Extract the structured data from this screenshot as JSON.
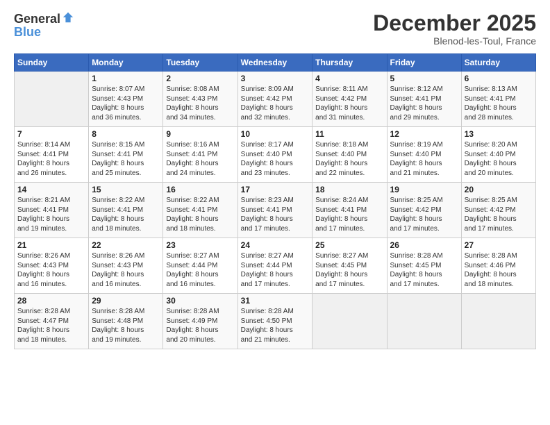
{
  "header": {
    "logo_general": "General",
    "logo_blue": "Blue",
    "month": "December 2025",
    "location": "Blenod-les-Toul, France"
  },
  "weekdays": [
    "Sunday",
    "Monday",
    "Tuesday",
    "Wednesday",
    "Thursday",
    "Friday",
    "Saturday"
  ],
  "weeks": [
    [
      {
        "day": "",
        "info": ""
      },
      {
        "day": "1",
        "info": "Sunrise: 8:07 AM\nSunset: 4:43 PM\nDaylight: 8 hours\nand 36 minutes."
      },
      {
        "day": "2",
        "info": "Sunrise: 8:08 AM\nSunset: 4:43 PM\nDaylight: 8 hours\nand 34 minutes."
      },
      {
        "day": "3",
        "info": "Sunrise: 8:09 AM\nSunset: 4:42 PM\nDaylight: 8 hours\nand 32 minutes."
      },
      {
        "day": "4",
        "info": "Sunrise: 8:11 AM\nSunset: 4:42 PM\nDaylight: 8 hours\nand 31 minutes."
      },
      {
        "day": "5",
        "info": "Sunrise: 8:12 AM\nSunset: 4:41 PM\nDaylight: 8 hours\nand 29 minutes."
      },
      {
        "day": "6",
        "info": "Sunrise: 8:13 AM\nSunset: 4:41 PM\nDaylight: 8 hours\nand 28 minutes."
      }
    ],
    [
      {
        "day": "7",
        "info": "Sunrise: 8:14 AM\nSunset: 4:41 PM\nDaylight: 8 hours\nand 26 minutes."
      },
      {
        "day": "8",
        "info": "Sunrise: 8:15 AM\nSunset: 4:41 PM\nDaylight: 8 hours\nand 25 minutes."
      },
      {
        "day": "9",
        "info": "Sunrise: 8:16 AM\nSunset: 4:41 PM\nDaylight: 8 hours\nand 24 minutes."
      },
      {
        "day": "10",
        "info": "Sunrise: 8:17 AM\nSunset: 4:40 PM\nDaylight: 8 hours\nand 23 minutes."
      },
      {
        "day": "11",
        "info": "Sunrise: 8:18 AM\nSunset: 4:40 PM\nDaylight: 8 hours\nand 22 minutes."
      },
      {
        "day": "12",
        "info": "Sunrise: 8:19 AM\nSunset: 4:40 PM\nDaylight: 8 hours\nand 21 minutes."
      },
      {
        "day": "13",
        "info": "Sunrise: 8:20 AM\nSunset: 4:40 PM\nDaylight: 8 hours\nand 20 minutes."
      }
    ],
    [
      {
        "day": "14",
        "info": "Sunrise: 8:21 AM\nSunset: 4:41 PM\nDaylight: 8 hours\nand 19 minutes."
      },
      {
        "day": "15",
        "info": "Sunrise: 8:22 AM\nSunset: 4:41 PM\nDaylight: 8 hours\nand 18 minutes."
      },
      {
        "day": "16",
        "info": "Sunrise: 8:22 AM\nSunset: 4:41 PM\nDaylight: 8 hours\nand 18 minutes."
      },
      {
        "day": "17",
        "info": "Sunrise: 8:23 AM\nSunset: 4:41 PM\nDaylight: 8 hours\nand 17 minutes."
      },
      {
        "day": "18",
        "info": "Sunrise: 8:24 AM\nSunset: 4:41 PM\nDaylight: 8 hours\nand 17 minutes."
      },
      {
        "day": "19",
        "info": "Sunrise: 8:25 AM\nSunset: 4:42 PM\nDaylight: 8 hours\nand 17 minutes."
      },
      {
        "day": "20",
        "info": "Sunrise: 8:25 AM\nSunset: 4:42 PM\nDaylight: 8 hours\nand 17 minutes."
      }
    ],
    [
      {
        "day": "21",
        "info": "Sunrise: 8:26 AM\nSunset: 4:43 PM\nDaylight: 8 hours\nand 16 minutes."
      },
      {
        "day": "22",
        "info": "Sunrise: 8:26 AM\nSunset: 4:43 PM\nDaylight: 8 hours\nand 16 minutes."
      },
      {
        "day": "23",
        "info": "Sunrise: 8:27 AM\nSunset: 4:44 PM\nDaylight: 8 hours\nand 16 minutes."
      },
      {
        "day": "24",
        "info": "Sunrise: 8:27 AM\nSunset: 4:44 PM\nDaylight: 8 hours\nand 17 minutes."
      },
      {
        "day": "25",
        "info": "Sunrise: 8:27 AM\nSunset: 4:45 PM\nDaylight: 8 hours\nand 17 minutes."
      },
      {
        "day": "26",
        "info": "Sunrise: 8:28 AM\nSunset: 4:45 PM\nDaylight: 8 hours\nand 17 minutes."
      },
      {
        "day": "27",
        "info": "Sunrise: 8:28 AM\nSunset: 4:46 PM\nDaylight: 8 hours\nand 18 minutes."
      }
    ],
    [
      {
        "day": "28",
        "info": "Sunrise: 8:28 AM\nSunset: 4:47 PM\nDaylight: 8 hours\nand 18 minutes."
      },
      {
        "day": "29",
        "info": "Sunrise: 8:28 AM\nSunset: 4:48 PM\nDaylight: 8 hours\nand 19 minutes."
      },
      {
        "day": "30",
        "info": "Sunrise: 8:28 AM\nSunset: 4:49 PM\nDaylight: 8 hours\nand 20 minutes."
      },
      {
        "day": "31",
        "info": "Sunrise: 8:28 AM\nSunset: 4:50 PM\nDaylight: 8 hours\nand 21 minutes."
      },
      {
        "day": "",
        "info": ""
      },
      {
        "day": "",
        "info": ""
      },
      {
        "day": "",
        "info": ""
      }
    ]
  ]
}
